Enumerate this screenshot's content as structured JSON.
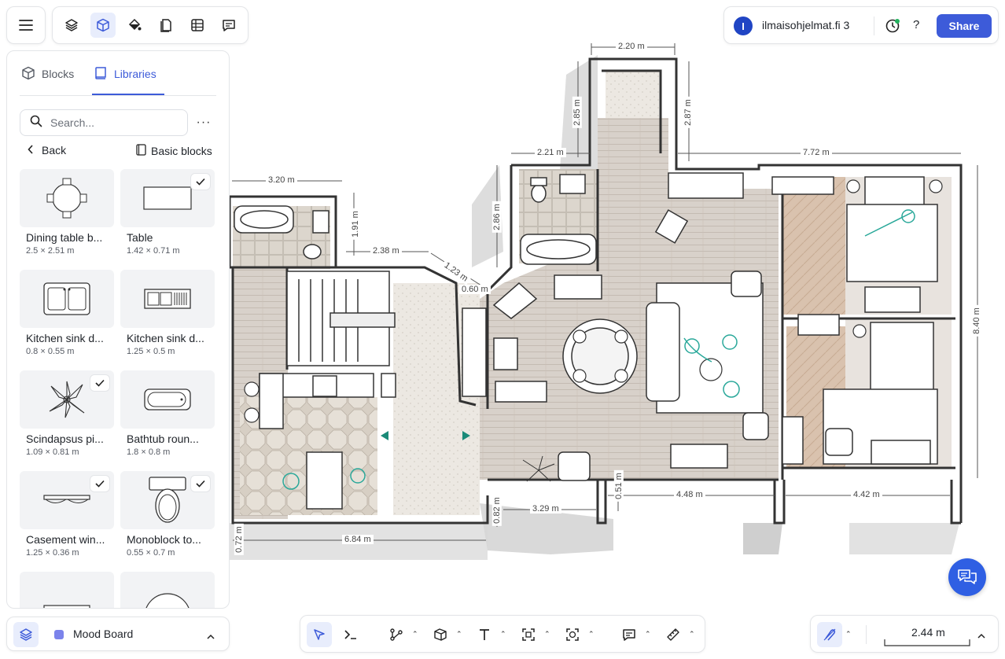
{
  "topbar": {
    "tools": [
      "menu-icon",
      "layers-icon",
      "cube-icon",
      "paint-bucket-icon",
      "pages-icon",
      "table-icon",
      "comment-icon"
    ],
    "active_tool": "cube-icon"
  },
  "account": {
    "avatar_letter": "I",
    "project_name": "ilmaisohjelmat.fi 3",
    "help_label": "?",
    "share_label": "Share"
  },
  "panel": {
    "tabs": [
      {
        "label": "Blocks",
        "icon": "cube-icon",
        "active": false
      },
      {
        "label": "Libraries",
        "icon": "book-icon",
        "active": true
      }
    ],
    "search_placeholder": "Search...",
    "more_label": "···",
    "back_label": "Back",
    "library_name": "Basic blocks",
    "items": [
      {
        "name": "Dining table b...",
        "size": "2.5 × 2.51 m",
        "checked": false
      },
      {
        "name": "Table",
        "size": "1.42 × 0.71 m",
        "checked": true
      },
      {
        "name": "Kitchen sink d...",
        "size": "0.8 × 0.55 m",
        "checked": false
      },
      {
        "name": "Kitchen sink d...",
        "size": "1.25 × 0.5 m",
        "checked": false
      },
      {
        "name": "Scindapsus pi...",
        "size": "1.09 × 0.81 m",
        "checked": true
      },
      {
        "name": "Bathtub roun...",
        "size": "1.8 × 0.8 m",
        "checked": false
      },
      {
        "name": "Casement win...",
        "size": "1.25 × 0.36 m",
        "checked": true
      },
      {
        "name": "Monoblock to...",
        "size": "0.55 × 0.7 m",
        "checked": true
      }
    ]
  },
  "layer": {
    "name": "Mood Board",
    "color": "#7b83eb"
  },
  "bottom_tools": [
    "select-arrow-icon",
    "command-icon",
    "path-icon",
    "wall-icon",
    "text-icon",
    "frame-icon",
    "capture-icon",
    "comment-icon",
    "measure-icon"
  ],
  "scale": {
    "value": "2.44 m"
  },
  "dimensions": {
    "top_hall_width": "2.20 m",
    "top_hall_left_h": "2.85 m",
    "top_hall_right_h": "2.87 m",
    "bath_width": "2.21 m",
    "living_width": "7.72 m",
    "left_bath_width": "3.20 m",
    "left_bath_h": "1.91 m",
    "stair_gap": "2.38 m",
    "diag": "1.23 m",
    "small": "0.60 m",
    "bath2_h": "2.86 m",
    "right_h": "8.40 m",
    "bottom_left": "6.84 m",
    "bottom_left_h": "0.72 m",
    "bottom_mid_h": "0.82 m",
    "bottom_mid": "3.29 m",
    "bottom_small_h": "0.51 m",
    "bottom_r1": "4.48 m",
    "bottom_r2": "4.42 m"
  }
}
